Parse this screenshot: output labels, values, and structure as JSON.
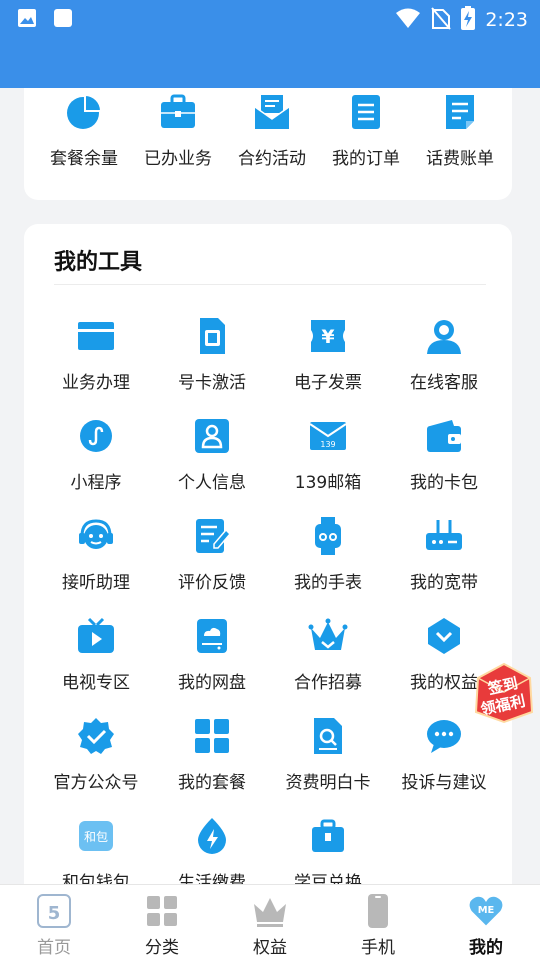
{
  "status_bar": {
    "time": "2:23",
    "left_icons": [
      "image-icon",
      "app-square-icon"
    ],
    "right_icons": [
      "wifi-icon",
      "no-sim-icon",
      "battery-charging-icon"
    ]
  },
  "quick_access": [
    {
      "label": "套餐余量",
      "icon": "pie-chart-icon"
    },
    {
      "label": "已办业务",
      "icon": "briefcase-icon"
    },
    {
      "label": "合约活动",
      "icon": "mail-open-icon"
    },
    {
      "label": "我的订单",
      "icon": "list-doc-icon"
    },
    {
      "label": "话费账单",
      "icon": "bill-doc-icon"
    }
  ],
  "tools": {
    "title": "我的工具",
    "items": [
      {
        "label": "业务办理",
        "icon": "service-card-icon"
      },
      {
        "label": "号卡激活",
        "icon": "sim-card-icon"
      },
      {
        "label": "电子发票",
        "icon": "invoice-icon"
      },
      {
        "label": "在线客服",
        "icon": "customer-service-icon"
      },
      {
        "label": "小程序",
        "icon": "mini-program-icon"
      },
      {
        "label": "个人信息",
        "icon": "profile-icon"
      },
      {
        "label": "139邮箱",
        "icon": "mailbox-139-icon",
        "icon_text": "139"
      },
      {
        "label": "我的卡包",
        "icon": "wallet-icon"
      },
      {
        "label": "接听助理",
        "icon": "call-assistant-icon"
      },
      {
        "label": "评价反馈",
        "icon": "feedback-icon"
      },
      {
        "label": "我的手表",
        "icon": "smartwatch-icon"
      },
      {
        "label": "我的宽带",
        "icon": "router-icon"
      },
      {
        "label": "电视专区",
        "icon": "tv-icon"
      },
      {
        "label": "我的网盘",
        "icon": "cloud-drive-icon"
      },
      {
        "label": "合作招募",
        "icon": "crown-icon"
      },
      {
        "label": "我的权益",
        "icon": "shield-check-icon"
      },
      {
        "label": "官方公众号",
        "icon": "verified-badge-icon"
      },
      {
        "label": "我的套餐",
        "icon": "grid-apps-icon"
      },
      {
        "label": "资费明白卡",
        "icon": "search-doc-icon"
      },
      {
        "label": "投诉与建议",
        "icon": "chat-bubble-icon"
      },
      {
        "label": "和包钱包",
        "icon": "hebao-icon",
        "icon_text": "和包"
      },
      {
        "label": "生活缴费",
        "icon": "lightning-icon"
      },
      {
        "label": "学豆兑换",
        "icon": "gift-box-icon"
      }
    ]
  },
  "floating_badge": {
    "line1": "签到",
    "line2": "领福利"
  },
  "tabbar": [
    {
      "label": "首页",
      "icon": "home-5g-icon",
      "state": "dim"
    },
    {
      "label": "分类",
      "icon": "category-icon",
      "state": "normal"
    },
    {
      "label": "权益",
      "icon": "crown-tab-icon",
      "state": "normal"
    },
    {
      "label": "手机",
      "icon": "phone-icon",
      "state": "normal"
    },
    {
      "label": "我的",
      "icon": "me-heart-icon",
      "state": "active",
      "icon_text": "ME"
    }
  ],
  "colors": {
    "primary": "#3a8fe9",
    "icon_blue": "#1a9be8",
    "tab_gray": "#b8b8b8",
    "badge_red": "#e83b3b"
  }
}
